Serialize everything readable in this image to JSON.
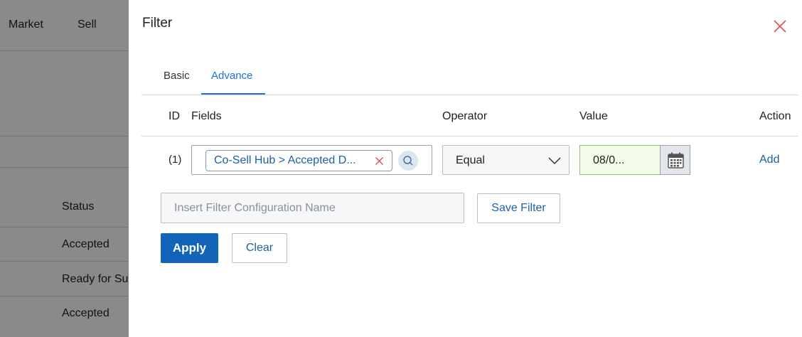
{
  "background": {
    "nav": [
      "Market",
      "Sell"
    ],
    "status_header": "Status",
    "status_rows": [
      "Accepted",
      "Ready for Su",
      "Accepted"
    ]
  },
  "drawer": {
    "title": "Filter",
    "tabs": [
      {
        "label": "Basic",
        "active": false
      },
      {
        "label": "Advance",
        "active": true
      }
    ],
    "columns": {
      "id": "ID",
      "fields": "Fields",
      "operator": "Operator",
      "value": "Value",
      "action": "Action"
    },
    "rows": [
      {
        "id": "(1)",
        "field_chip": "Co-Sell Hub > Accepted D...",
        "operator": "Equal",
        "value": "08/0...",
        "action": "Add"
      }
    ],
    "config_name_placeholder": "Insert Filter Configuration Name",
    "save_filter_label": "Save Filter",
    "apply_label": "Apply",
    "clear_label": "Clear"
  },
  "icons": {
    "close": "close-icon",
    "chip_remove": "remove-chip-icon",
    "search": "search-icon",
    "operator_dropdown": "chevron-down-icon",
    "calendar": "calendar-icon"
  },
  "colors": {
    "accent": "#1f6fd1",
    "link": "#1f5fa8",
    "primary_button": "#1264b8",
    "close_red": "#d9534f",
    "date_highlight": "#f4fbe9"
  }
}
